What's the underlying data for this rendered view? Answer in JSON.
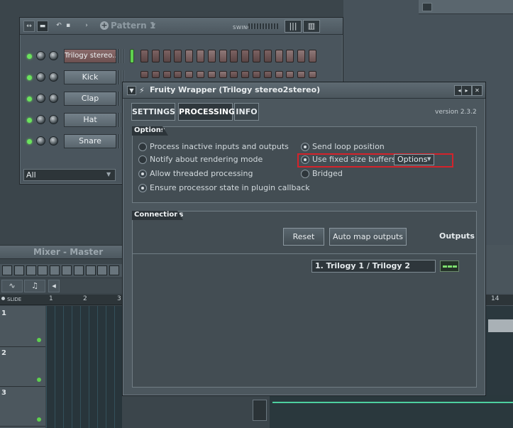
{
  "step_sequencer": {
    "pattern_label": "Pattern 1",
    "swing_label": "SWING",
    "channel_filter": "All",
    "channels": [
      {
        "label": "Trilogy stereo..."
      },
      {
        "label": "Kick"
      },
      {
        "label": "Clap"
      },
      {
        "label": "Hat"
      },
      {
        "label": "Snare"
      }
    ]
  },
  "mixer": {
    "title": "Mixer - Master"
  },
  "playlist": {
    "slide_label": "SLIDE",
    "ruler_numbers": [
      "1",
      "2",
      "3"
    ],
    "right_ruler_number": "14",
    "tracks": [
      "1",
      "2",
      "3"
    ]
  },
  "dialog": {
    "title": "Fruity Wrapper (Trilogy stereo2stereo)",
    "tabs": [
      "SETTINGS",
      "PROCESSING",
      "INFO"
    ],
    "active_tab": "PROCESSING",
    "version": "version 2.3.2",
    "options_group": {
      "label": "Options",
      "left_items": [
        {
          "label": "Process inactive inputs and outputs",
          "checked": false
        },
        {
          "label": "Notify about rendering mode",
          "checked": false
        },
        {
          "label": "Allow threaded processing",
          "checked": true
        },
        {
          "label": "Ensure processor state in plugin callback",
          "checked": true
        }
      ],
      "right_items": [
        {
          "label": "Send loop position",
          "checked": true
        },
        {
          "label": "Use fixed size buffers",
          "checked": true
        },
        {
          "label": "Bridged",
          "checked": false
        }
      ],
      "options_button": "Options"
    },
    "connections_group": {
      "label": "Connections",
      "reset_button": "Reset",
      "auto_map_button": "Auto map outputs",
      "outputs_label": "Outputs",
      "output_value": "1. Trilogy 1 / Trilogy 2"
    }
  },
  "colors": {
    "highlight": "#d4232b",
    "led_green": "#6be35d"
  }
}
